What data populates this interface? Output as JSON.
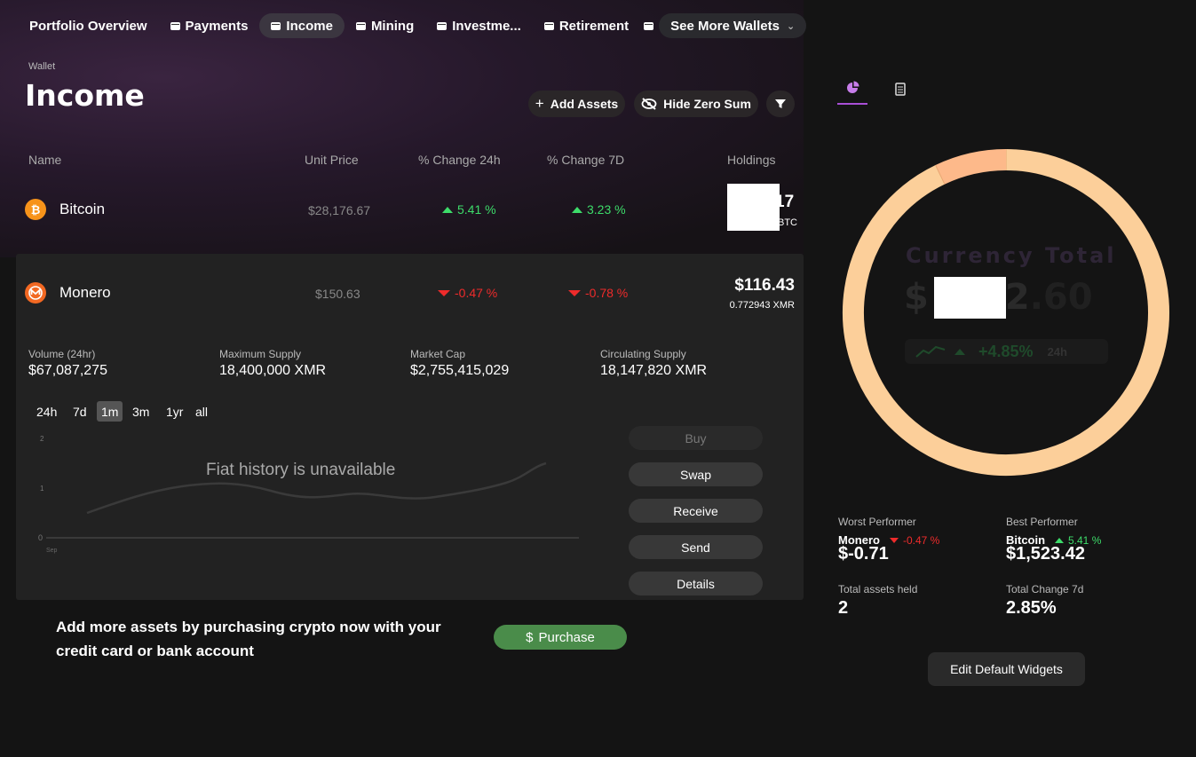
{
  "tabs": [
    {
      "label": "Portfolio Overview"
    },
    {
      "label": "Payments"
    },
    {
      "label": "Income"
    },
    {
      "label": "Mining"
    },
    {
      "label": "Investme..."
    },
    {
      "label": "Retirement"
    }
  ],
  "see_more_label": "See More Wallets",
  "header": {
    "crumb": "Wallet",
    "title": "Income"
  },
  "toolbar": {
    "add_assets": "Add Assets",
    "hide_zero": "Hide Zero Sum"
  },
  "columns": {
    "name": "Name",
    "unit_price": "Unit Price",
    "change24": "% Change 24h",
    "change7": "% Change 7D",
    "holdings": "Holdings"
  },
  "assets": [
    {
      "name": "Bitcoin",
      "unit_price": "$28,176.67",
      "change24": "5.41 %",
      "change7": "3.23 %",
      "holdings_value": "17",
      "holdings_amount": "BTC",
      "icon": "bitcoin-icon",
      "color": "#f7931a"
    },
    {
      "name": "Monero",
      "unit_price": "$150.63",
      "change24": "-0.47 %",
      "change7": "-0.78 %",
      "holdings_value": "$116.43",
      "holdings_amount": "0.772943 XMR",
      "icon": "monero-icon",
      "color": "#f26822"
    }
  ],
  "details": {
    "volume_label": "Volume (24hr)",
    "volume": "$67,087,275",
    "max_supply_label": "Maximum Supply",
    "max_supply": "18,400,000 XMR",
    "market_cap_label": "Market Cap",
    "market_cap": "$2,755,415,029",
    "circ_supply_label": "Circulating Supply",
    "circ_supply": "18,147,820 XMR"
  },
  "ranges": [
    "24h",
    "7d",
    "1m",
    "3m",
    "1yr",
    "all"
  ],
  "active_range": "1m",
  "chart": {
    "y_ticks": [
      "2",
      "1",
      "0"
    ],
    "x_tick": "Sep",
    "message": "Fiat history is unavailable"
  },
  "actions": {
    "buy": "Buy",
    "swap": "Swap",
    "receive": "Receive",
    "send": "Send",
    "details": "Details"
  },
  "cta": {
    "text": "Add more assets by purchasing crypto now with your credit card or bank account",
    "button": "Purchase",
    "button_icon": "$"
  },
  "summary": {
    "currency_label": "Currency Total",
    "currency_total_visible": "$",
    "currency_total_tail": "2.60",
    "currency_total_tail_bold": "2",
    "currency_total_tail_faint": ".60",
    "currency_change": "+4.85%",
    "currency_change_period": "24h",
    "donut_shares": [
      {
        "name": "Bitcoin",
        "share": 0.929,
        "color": "#fccf9a"
      },
      {
        "name": "Monero",
        "share": 0.071,
        "color": "#fdb98a"
      }
    ]
  },
  "performance": {
    "worst_label": "Worst Performer",
    "worst_name": "Monero",
    "worst_change": "-0.47 %",
    "worst_value": "$-0.71",
    "best_label": "Best Performer",
    "best_name": "Bitcoin",
    "best_change": "5.41 %",
    "best_value": "$1,523.42",
    "assets_held_label": "Total assets held",
    "assets_held": "2",
    "total_change_label": "Total Change 7d",
    "total_change": "2.85%"
  },
  "edit_widgets": "Edit Default Widgets"
}
